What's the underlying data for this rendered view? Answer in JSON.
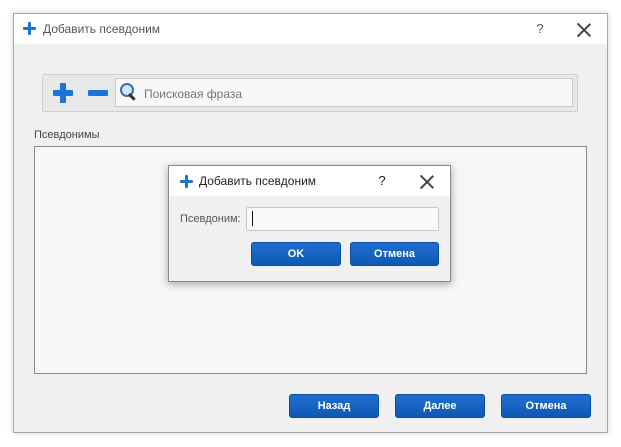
{
  "outer_dialog": {
    "title": "Добавить псевдоним",
    "help_label": "?",
    "toolbar": {
      "add_icon": "plus-icon",
      "remove_icon": "minus-icon",
      "search_icon": "magnifier-icon",
      "search_placeholder": "Поисковая фраза",
      "search_value": ""
    },
    "list_label": "Псевдонимы",
    "list_items": [],
    "buttons": {
      "back": "Назад",
      "next": "Далее",
      "cancel": "Отмена"
    }
  },
  "inner_dialog": {
    "title": "Добавить псевдоним",
    "help_label": "?",
    "field_label": "Псевдоним:",
    "field_value": "",
    "buttons": {
      "ok": "OK",
      "cancel": "Отмена"
    }
  },
  "colors": {
    "accent": "#1a73d6",
    "button": "#1260c2"
  }
}
